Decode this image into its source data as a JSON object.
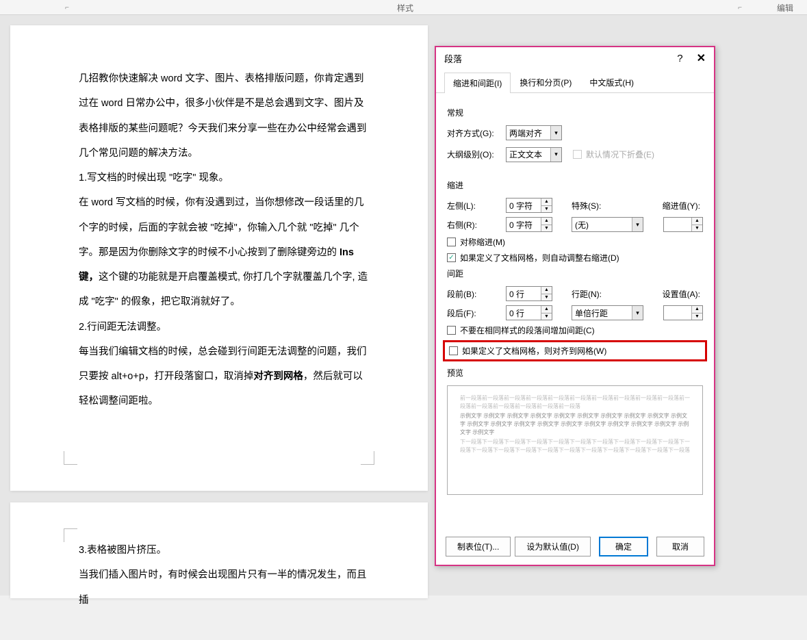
{
  "ribbon": {
    "styles_label": "样式",
    "edit_label": "编辑"
  },
  "document": {
    "p1": "几招教你快速解决 word 文字、图片、表格排版问题，你肯定遇到过在 word 日常办公中，很多小伙伴是不是总会遇到文字、图片及表格排版的某些问题呢？今天我们来分享一些在办公中经常会遇到几个常见问题的解决方法。",
    "p2": "1.写文档的时候出现 \"吃字\" 现象。",
    "p3a": "在 word 写文档的时候，你有没遇到过，当你想修改一段话里的几个字的时候，后面的字就会被 \"吃掉\"，你输入几个就 \"吃掉\" 几个字。那是因为你删除文字的时候不小心按到了删除键旁边的 ",
    "p3b": "Ins 键，",
    "p3c": "这个键的功能就是开启覆盖模式, 你打几个字就覆盖几个字, 造成 \"吃字\" 的假象，把它取消就好了。",
    "p4": "2.行间距无法调整。",
    "p5a": "每当我们编辑文档的时候，总会碰到行间距无法调整的问题，我们只要按 alt+o+p，打开段落窗口，取消掉",
    "p5b": "对齐到网格",
    "p5c": "，然后就可以轻松调整间距啦。",
    "p6": "3.表格被图片挤压。",
    "p7": "当我们插入图片时，有时候会出现图片只有一半的情况发生，而且插"
  },
  "dialog": {
    "title": "段落",
    "tabs": {
      "t1": "缩进和间距(I)",
      "t2": "换行和分页(P)",
      "t3": "中文版式(H)"
    },
    "general": {
      "section": "常规",
      "align_label": "对齐方式(G):",
      "align_value": "两端对齐",
      "outline_label": "大纲级别(O):",
      "outline_value": "正文文本",
      "collapse_label": "默认情况下折叠(E)"
    },
    "indent": {
      "section": "缩进",
      "left_label": "左侧(L):",
      "left_value": "0 字符",
      "right_label": "右侧(R):",
      "right_value": "0 字符",
      "special_label": "特殊(S):",
      "special_value": "(无)",
      "by_label": "缩进值(Y):",
      "mirror": "对称缩进(M)",
      "grid_auto": "如果定义了文档网格，则自动调整右缩进(D)"
    },
    "spacing": {
      "section": "间距",
      "before_label": "段前(B):",
      "before_value": "0 行",
      "after_label": "段后(F):",
      "after_value": "0 行",
      "line_label": "行距(N):",
      "line_value": "单倍行距",
      "at_label": "设置值(A):",
      "same_style": "不要在相同样式的段落间增加间距(C)",
      "snap_grid": "如果定义了文档网格，则对齐到网格(W)"
    },
    "preview_label": "预览",
    "preview": {
      "prev": "前一段落前一段落前一段落前一段落前一段落前一段落前一段落前一段落前一段落前一段落前一段落前一段落前一段落前一段落前一段落前一段落",
      "sample": "示例文字 示例文字 示例文字 示例文字 示例文字 示例文字 示例文字 示例文字 示例文字 示例文字 示例文字 示例文字 示例文字 示例文字 示例文字 示例文字 示例文字 示例文字 示例文字 示例文字 示例文字",
      "next": "下一段落下一段落下一段落下一段落下一段落下一段落下一段落下一段落下一段落下一段落下一段落下一段落下一段落下一段落下一段落下一段落下一段落下一段落下一段落下一段落下一段落"
    },
    "buttons": {
      "tabs": "制表位(T)...",
      "default": "设为默认值(D)",
      "ok": "确定",
      "cancel": "取消"
    }
  }
}
